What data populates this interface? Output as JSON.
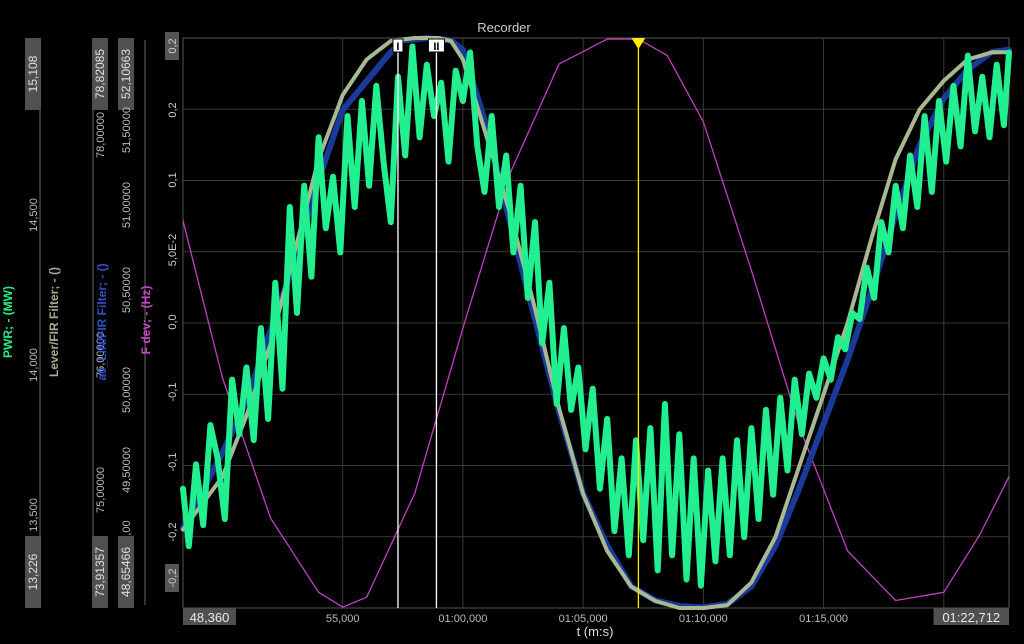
{
  "chart_data": {
    "type": "line",
    "title": "Recorder",
    "xlabel": "t (m:s)",
    "x_start_label": "48,360",
    "x_end_label": "01:22,712",
    "x_ticks": [
      {
        "t": 48.36,
        "label": "48,360"
      },
      {
        "t": 55.0,
        "label": "55,000"
      },
      {
        "t": 60.0,
        "label": "01:00,000"
      },
      {
        "t": 65.0,
        "label": "01:05,000"
      },
      {
        "t": 70.0,
        "label": "01:10,000"
      },
      {
        "t": 75.0,
        "label": "01:15,000"
      },
      {
        "t": 80.0,
        "label": "01:"
      },
      {
        "t": 82.712,
        "label": "01:22,712"
      }
    ],
    "xlim": [
      48.36,
      82.712
    ],
    "grid": true,
    "cursors": [
      {
        "t": 57.3,
        "label": "I",
        "color": "#ffffff"
      },
      {
        "t": 58.9,
        "label": "II",
        "color": "#ffffff"
      },
      {
        "t": 67.3,
        "label": "",
        "color": "#ffee00"
      }
    ],
    "axes": [
      {
        "name": "PWR; - (MW)",
        "color": "#22ee88",
        "min_label": "13,226",
        "max_label": "15,108",
        "ticks": [
          "13,500",
          "14,000",
          "14,500"
        ],
        "ylim": [
          13.226,
          15.108
        ]
      },
      {
        "name": "Lever/FIR Filter; - ()",
        "color": "#9fb08a",
        "min_label": "",
        "max_label": "",
        "ticks": [],
        "ylim": [
          -0.2,
          0.2
        ]
      },
      {
        "name": "a0_LIN/FIR Filter; - ()",
        "color": "#3050c8",
        "min_label": "73,91357",
        "max_label": "78,82085",
        "ticks": [
          "75,00000",
          "76,00000",
          "78,00000"
        ],
        "ylim": [
          73.91357,
          78.82085
        ]
      },
      {
        "name": "F dev; - (Hz)",
        "color": "#cc44cc",
        "min_label": "48,65466",
        "max_label": "52,10663",
        "ticks": [
          "49,50000",
          "50,00000",
          "50,50000",
          "51,00000",
          "51,50000"
        ],
        "tick_prefix_min": ",00",
        "ylim": [
          48.65466,
          52.10663
        ]
      }
    ],
    "right_axis": {
      "ylim": [
        -0.2,
        0.2
      ],
      "ticks": [
        "0,2",
        "0,2",
        "0,1",
        "5,0E-2",
        "0,0",
        "-0,1",
        "-0,1",
        "-0,2",
        "-0,2"
      ]
    },
    "series": [
      {
        "name": "F dev; - (Hz)",
        "color": "#c040c0",
        "width": 1.3,
        "t": [
          48.36,
          50.0,
          52.0,
          54.0,
          55.0,
          56.0,
          58.0,
          60.0,
          62.0,
          64.0,
          66.0,
          67.3,
          68.5,
          70.0,
          72.0,
          74.0,
          76.0,
          78.0,
          80.0,
          81.5,
          82.712
        ],
        "values": [
          51.0,
          50.05,
          49.2,
          48.75,
          48.66,
          48.72,
          49.35,
          50.35,
          51.3,
          51.95,
          52.1,
          52.1,
          52.0,
          51.6,
          50.7,
          49.75,
          49.0,
          48.7,
          48.75,
          49.1,
          49.45
        ]
      },
      {
        "name": "a0_LIN/FIR Filter; - ()",
        "color": "#1a3a9a",
        "width": 6,
        "t": [
          48.36,
          50.0,
          51.0,
          52.0,
          53.0,
          54.0,
          55.0,
          56.0,
          57.0,
          57.5,
          58.5,
          59.5,
          60.0,
          61.0,
          62.0,
          63.0,
          64.0,
          65.0,
          66.0,
          67.0,
          68.0,
          69.0,
          70.0,
          71.0,
          72.0,
          73.0,
          74.0,
          75.0,
          76.0,
          77.0,
          78.0,
          79.0,
          80.0,
          81.0,
          82.0,
          82.712
        ],
        "values": [
          74.6,
          75.25,
          75.7,
          76.3,
          76.9,
          77.6,
          78.2,
          78.45,
          78.7,
          78.8,
          78.82,
          78.8,
          78.72,
          78.05,
          77.2,
          76.4,
          75.6,
          74.9,
          74.45,
          74.1,
          73.98,
          73.93,
          73.92,
          73.95,
          74.1,
          74.45,
          74.95,
          75.5,
          76.05,
          76.65,
          77.3,
          77.9,
          78.3,
          78.55,
          78.7,
          78.72
        ]
      },
      {
        "name": "Lever/FIR Filter; - ()",
        "color": "#a8b890",
        "width": 4,
        "t": [
          48.36,
          50.0,
          51.0,
          52.0,
          53.0,
          54.0,
          55.0,
          56.0,
          57.0,
          58.0,
          59.0,
          59.5,
          60.0,
          61.0,
          62.0,
          63.0,
          64.0,
          65.0,
          66.0,
          67.0,
          68.0,
          69.0,
          70.0,
          71.0,
          72.0,
          73.0,
          74.0,
          75.0,
          76.0,
          77.0,
          78.0,
          79.0,
          80.0,
          81.0,
          82.0,
          82.712
        ],
        "values": [
          -0.145,
          -0.108,
          -0.065,
          -0.015,
          0.05,
          0.115,
          0.16,
          0.185,
          0.198,
          0.2,
          0.2,
          0.198,
          0.185,
          0.13,
          0.075,
          0.01,
          -0.06,
          -0.12,
          -0.16,
          -0.185,
          -0.195,
          -0.2,
          -0.2,
          -0.198,
          -0.182,
          -0.15,
          -0.1,
          -0.05,
          0.0,
          0.06,
          0.115,
          0.15,
          0.17,
          0.185,
          0.19,
          0.19
        ]
      },
      {
        "name": "PWR; - (MW)",
        "color": "#22f090",
        "width": 6,
        "t": [
          48.36,
          48.6,
          48.9,
          49.2,
          49.5,
          49.8,
          50.1,
          50.4,
          50.7,
          51.0,
          51.3,
          51.6,
          51.9,
          52.2,
          52.5,
          52.8,
          53.1,
          53.4,
          53.7,
          54.0,
          54.3,
          54.6,
          54.9,
          55.2,
          55.5,
          55.8,
          56.1,
          56.4,
          56.7,
          57.0,
          57.3,
          57.6,
          57.9,
          58.2,
          58.5,
          58.8,
          59.1,
          59.4,
          59.7,
          60.0,
          60.3,
          60.6,
          60.9,
          61.2,
          61.5,
          61.8,
          62.1,
          62.4,
          62.7,
          63.0,
          63.3,
          63.6,
          63.9,
          64.2,
          64.5,
          64.8,
          65.1,
          65.4,
          65.7,
          66.0,
          66.3,
          66.6,
          66.9,
          67.2,
          67.5,
          67.8,
          68.1,
          68.4,
          68.7,
          69.0,
          69.3,
          69.6,
          69.9,
          70.2,
          70.5,
          70.8,
          71.1,
          71.4,
          71.7,
          72.0,
          72.3,
          72.6,
          72.9,
          73.2,
          73.5,
          73.8,
          74.1,
          74.4,
          74.7,
          75.0,
          75.3,
          75.6,
          75.9,
          76.2,
          76.5,
          76.8,
          77.1,
          77.4,
          77.7,
          78.0,
          78.3,
          78.6,
          78.9,
          79.2,
          79.5,
          79.8,
          80.1,
          80.4,
          80.7,
          81.0,
          81.3,
          81.6,
          81.9,
          82.2,
          82.5,
          82.712
        ],
        "values": [
          13.62,
          13.43,
          13.7,
          13.5,
          13.83,
          13.72,
          13.52,
          13.98,
          13.8,
          14.02,
          13.78,
          14.15,
          13.85,
          14.3,
          13.95,
          14.55,
          14.2,
          14.62,
          14.32,
          14.78,
          14.48,
          14.65,
          14.4,
          14.85,
          14.55,
          14.9,
          14.62,
          14.95,
          14.7,
          14.5,
          14.98,
          14.72,
          15.08,
          14.78,
          15.02,
          14.85,
          14.96,
          14.7,
          15.0,
          14.9,
          15.06,
          14.75,
          14.6,
          14.85,
          14.55,
          14.72,
          14.4,
          14.62,
          14.25,
          14.5,
          14.1,
          14.3,
          13.9,
          14.15,
          13.88,
          14.02,
          13.75,
          13.95,
          13.62,
          13.85,
          13.48,
          13.72,
          13.4,
          13.78,
          13.45,
          13.82,
          13.35,
          13.9,
          13.4,
          13.8,
          13.32,
          13.72,
          13.3,
          13.68,
          13.38,
          13.72,
          13.4,
          13.78,
          13.46,
          13.82,
          13.52,
          13.88,
          13.6,
          13.92,
          13.68,
          13.98,
          13.8,
          14.0,
          13.92,
          14.05,
          13.98,
          14.12,
          14.08,
          14.2,
          14.18,
          14.35,
          14.25,
          14.5,
          14.4,
          14.62,
          14.48,
          14.72,
          14.55,
          14.85,
          14.6,
          14.9,
          14.7,
          14.95,
          14.75,
          15.05,
          14.8,
          14.98,
          14.78,
          15.02,
          14.82,
          15.06
        ]
      }
    ]
  }
}
